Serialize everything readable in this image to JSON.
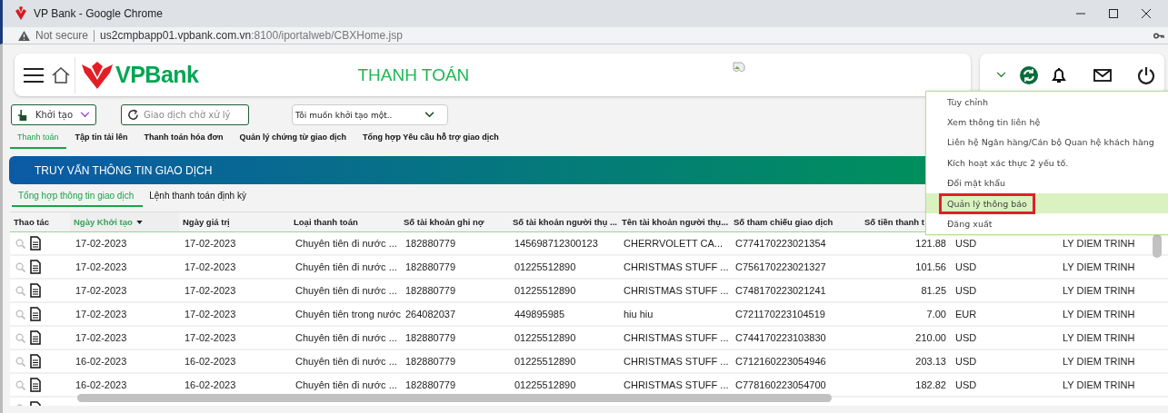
{
  "browser": {
    "tab_title": "VP Bank - Google Chrome",
    "security_label": "Not secure",
    "url_host": "us2cmpbapp01.vpbank.com.vn",
    "url_path": ":8100/iportalweb/CBXHome.jsp"
  },
  "header": {
    "logo_text": "VPBank",
    "page_title": "THANH TOÁN"
  },
  "toolbar": {
    "create_button": "Khởi tạo",
    "pending_button": "Giao dịch chờ xử lý",
    "action_select": "Tôi muốn khởi tạo một.."
  },
  "nav_tabs": [
    {
      "label": "Thanh toán",
      "selected": true
    },
    {
      "label": "Tập tin tải lên",
      "selected": false
    },
    {
      "label": "Thanh toán hóa đơn",
      "selected": false
    },
    {
      "label": "Quản lý chứng từ giao dịch",
      "selected": false
    },
    {
      "label": "Tổng hợp Yêu cầu hỗ trợ giao dịch",
      "selected": false
    }
  ],
  "section_title": "TRUY VẤN THÔNG TIN GIAO DỊCH",
  "sub_tabs": [
    {
      "label": "Tổng hợp thông tin giao dịch",
      "selected": true
    },
    {
      "label": "Lệnh thanh toán định kỳ",
      "selected": false
    }
  ],
  "table": {
    "columns": [
      {
        "label": "Thao tác",
        "sorted": false
      },
      {
        "label": "Ngày Khởi tạo",
        "sorted": true
      },
      {
        "label": "Ngày giá trị",
        "sorted": false
      },
      {
        "label": "Loại thanh toán",
        "sorted": false
      },
      {
        "label": "Số tài khoản ghi nợ",
        "sorted": false
      },
      {
        "label": "Số tài khoản người thụ ...",
        "sorted": false
      },
      {
        "label": "Tên tài khoản người thụ...",
        "sorted": false
      },
      {
        "label": "Số tham chiếu giao dịch",
        "sorted": false
      },
      {
        "label": "Số tiền thanh t",
        "sorted": false
      }
    ],
    "rows": [
      {
        "cells": [
          "",
          "17-02-2023",
          "17-02-2023",
          "Chuyên tiên đi nước ...",
          "182880779",
          "145698712300123",
          "CHERRVOLETT CA...",
          "C774170223021354",
          "121.88",
          "USD",
          "LY DIEM TRINH"
        ]
      },
      {
        "cells": [
          "",
          "17-02-2023",
          "17-02-2023",
          "Chuyên tiên đi nước ...",
          "182880779",
          "01225512890",
          "CHRISTMAS STUFF ...",
          "C756170223021327",
          "101.56",
          "USD",
          "LY DIEM TRINH"
        ]
      },
      {
        "cells": [
          "",
          "17-02-2023",
          "17-02-2023",
          "Chuyên tiên đi nước ...",
          "182880779",
          "01225512890",
          "CHRISTMAS STUFF ...",
          "C748170223021241",
          "81.25",
          "USD",
          "LY DIEM TRINH"
        ]
      },
      {
        "cells": [
          "",
          "17-02-2023",
          "17-02-2023",
          "Chuyên tiên trong nước",
          "264082037",
          "449895985",
          "hiu hiu",
          "C721170223104519",
          "7.00",
          "EUR",
          "LY DIEM TRINH"
        ]
      },
      {
        "cells": [
          "",
          "17-02-2023",
          "17-02-2023",
          "Chuyên tiên đi nước ...",
          "182880779",
          "01225512890",
          "CHRISTMAS STUFF ...",
          "C744170223103830",
          "210.00",
          "USD",
          "LY DIEM TRINH"
        ]
      },
      {
        "cells": [
          "",
          "16-02-2023",
          "16-02-2023",
          "Chuyên tiên đi nước ...",
          "182880779",
          "01225512890",
          "CHRISTMAS STUFF ...",
          "C712160223054946",
          "203.13",
          "USD",
          "LY DIEM TRINH"
        ]
      },
      {
        "cells": [
          "",
          "16-02-2023",
          "16-02-2023",
          "Chuyên tiên đi nước ...",
          "182880779",
          "01225512890",
          "CHRISTMAS STUFF ...",
          "C778160223054700",
          "182.82",
          "USD",
          "LY DIEM TRINH"
        ]
      }
    ]
  },
  "user_menu": {
    "items": [
      {
        "label": "Tùy chỉnh",
        "selected": false
      },
      {
        "label": "Xem thông tin liên hệ",
        "selected": false
      },
      {
        "label": "Liên hệ Ngân hàng/Cán bộ Quan hệ khách hàng",
        "selected": false
      },
      {
        "label": "Kích hoạt xác thực 2 yếu tố.",
        "selected": false
      },
      {
        "label": "Đổi mật khẩu",
        "selected": false
      },
      {
        "label": "Quản lý thông báo",
        "selected": true
      },
      {
        "label": "Đăng xuất",
        "selected": false
      }
    ]
  }
}
